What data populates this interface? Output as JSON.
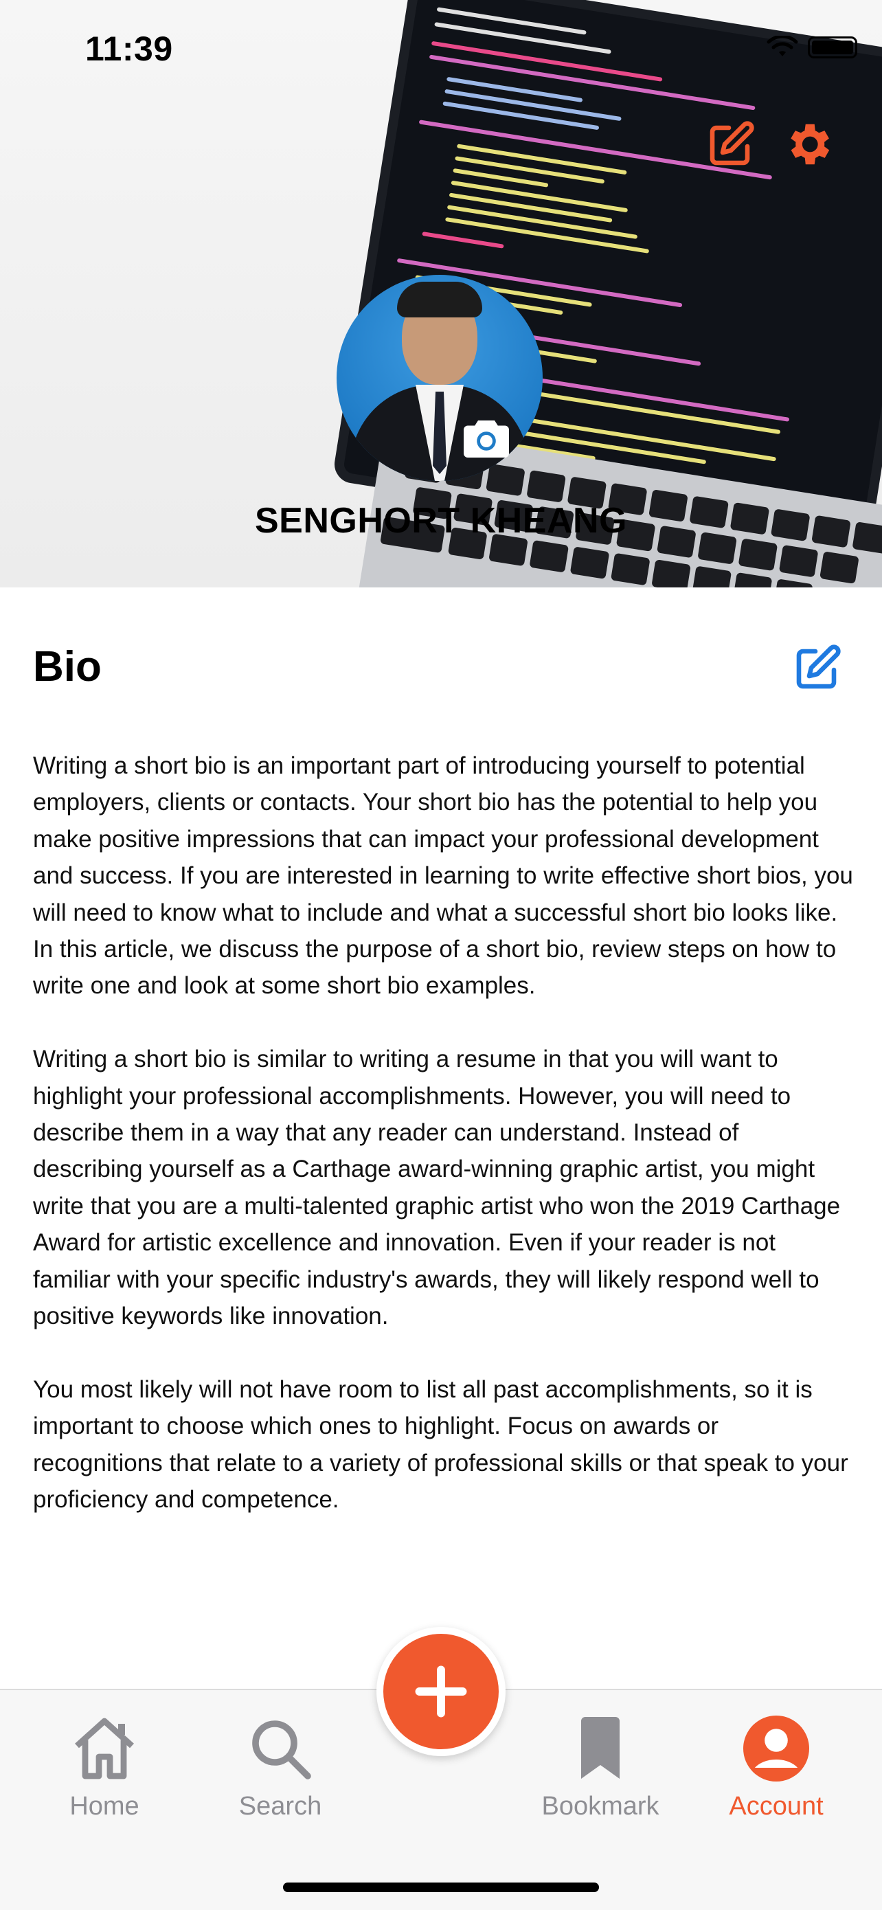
{
  "status_bar": {
    "time": "11:39"
  },
  "profile": {
    "name": "SENGHORT KHEANG"
  },
  "bio": {
    "title": "Bio",
    "paragraphs": [
      "Writing a short bio is an important part of introducing yourself to potential employers, clients or contacts. Your short bio has the potential to help you make positive impressions that can impact your professional development and success. If you are interested in learning to write effective short bios, you will need to know what to include and what a successful short bio looks like. In this article, we discuss the purpose of a short bio, review steps on how to write one and look at some short bio examples.",
      "Writing a short bio is similar to writing a resume in that you will want to highlight your professional accomplishments. However, you will need to describe them in a way that any reader can understand. Instead of describing yourself as a Carthage award-winning graphic artist, you might write that you are a multi-talented graphic artist who won the 2019 Carthage Award for artistic excellence and innovation. Even if your reader is not familiar with your specific industry's awards, they will likely respond well to positive keywords like innovation.",
      "You most likely will not have room to list all past accomplishments, so it is important to choose which ones to highlight. Focus on awards or recognitions that relate to a variety of professional skills or that speak to your proficiency and competence."
    ]
  },
  "tabbar": {
    "tabs": [
      {
        "label": "Home",
        "icon": "home-icon",
        "active": false
      },
      {
        "label": "Search",
        "icon": "search-icon",
        "active": false
      },
      {
        "label": "Bookmark",
        "icon": "bookmark-icon",
        "active": false
      },
      {
        "label": "Account",
        "icon": "account-icon",
        "active": true
      }
    ],
    "fab_icon": "plus-icon"
  },
  "colors": {
    "accent": "#f0592e",
    "bio_edit": "#1f7ae0",
    "inactive": "#8e8e93"
  }
}
